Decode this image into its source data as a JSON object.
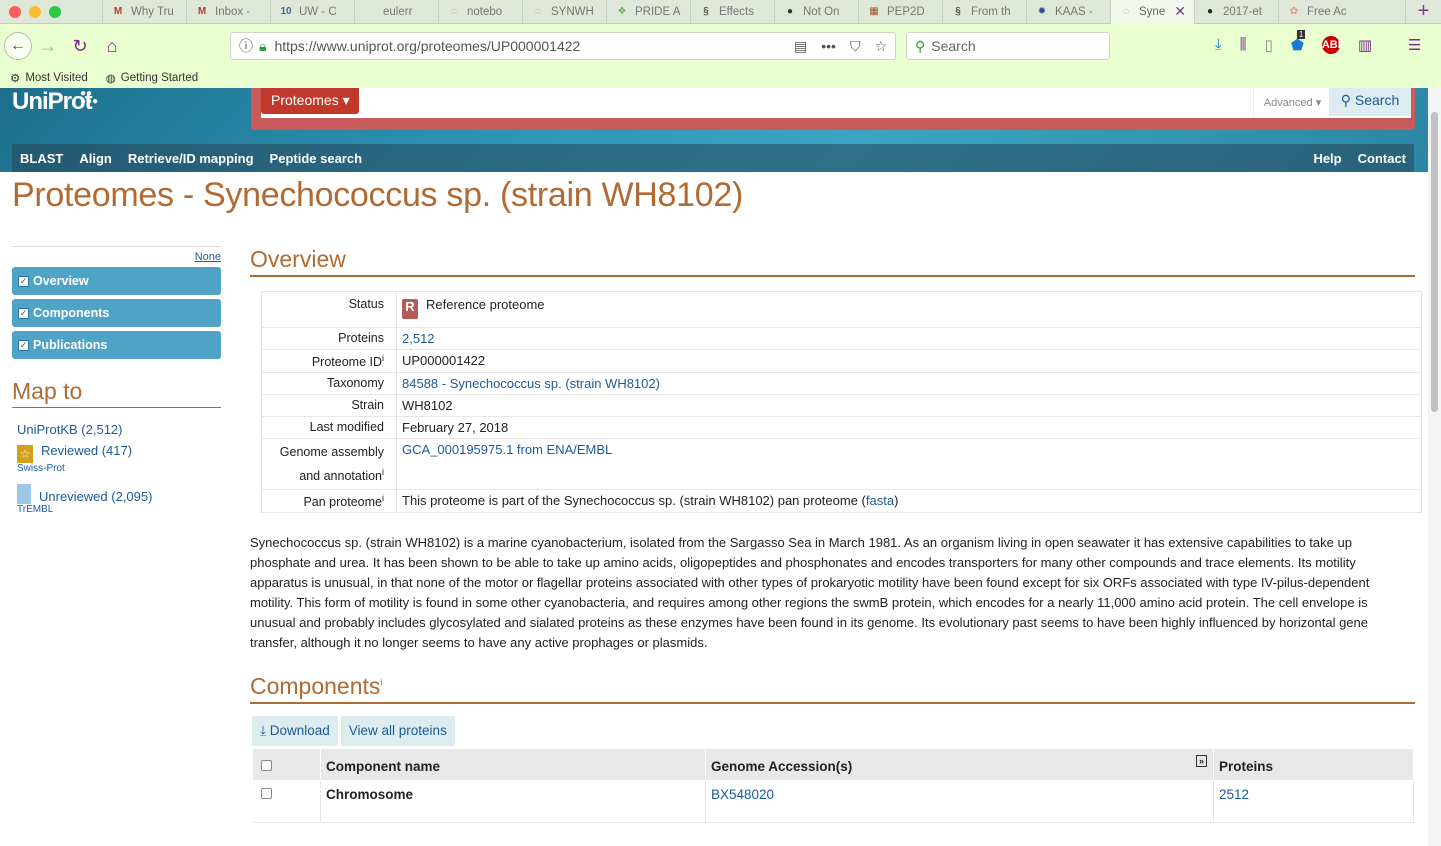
{
  "browser": {
    "tabs": [
      {
        "label": "Why Tru",
        "icon": "M",
        "color": "#c0392b"
      },
      {
        "label": "Inbox -",
        "icon": "M",
        "color": "#c0392b"
      },
      {
        "label": "UW - C",
        "icon": "10",
        "color": "#2a6fb0"
      },
      {
        "label": "eulerr",
        "icon": "",
        "color": "#888"
      },
      {
        "label": "notebo",
        "icon": "◌",
        "color": "#e67e22"
      },
      {
        "label": "SYNWH",
        "icon": "◌",
        "color": "#e67e22"
      },
      {
        "label": "PRIDE A",
        "icon": "❖",
        "color": "#6ab04c"
      },
      {
        "label": "Effects",
        "icon": "§",
        "color": "#555"
      },
      {
        "label": "Not On",
        "icon": "●",
        "color": "#333"
      },
      {
        "label": "PEP2D",
        "icon": "▦",
        "color": "#a0522d"
      },
      {
        "label": "From th",
        "icon": "§",
        "color": "#555"
      },
      {
        "label": "KAAS -",
        "icon": "✹",
        "color": "#2a4f8a"
      },
      {
        "label": "Syne",
        "icon": "◌",
        "color": "#4aa3d0",
        "active": true
      },
      {
        "label": "2017-et",
        "icon": "●",
        "color": "#222"
      },
      {
        "label": "Free Ac",
        "icon": "✿",
        "color": "#d98"
      }
    ],
    "url": "https://www.uniprot.org/proteomes/UP000001422",
    "search_placeholder": "Search",
    "notification_count": "1",
    "bookmarks": [
      "Most Visited",
      "Getting Started"
    ]
  },
  "site": {
    "logo": "UniProt",
    "dataset_button": "Proteomes ▾",
    "advanced": "Advanced ▾",
    "search_button": "Search",
    "menu_left": [
      "BLAST",
      "Align",
      "Retrieve/ID mapping",
      "Peptide search"
    ],
    "menu_right": [
      "Help",
      "Contact"
    ]
  },
  "page_title": "Proteomes - Synechococcus sp. (strain WH8102)",
  "sidenav": {
    "none_label": "None",
    "items": [
      "Overview",
      "Components",
      "Publications"
    ]
  },
  "mapto": {
    "heading": "Map to",
    "uniprotkb": "UniProtKB (2,512)",
    "reviewed": "Reviewed (417)",
    "reviewed_sub": "Swiss-Prot",
    "unreviewed": "Unreviewed (2,095)",
    "unreviewed_sub": "TrEMBL"
  },
  "overview": {
    "heading": "Overview",
    "rows": {
      "status_k": "Status",
      "status_v": "Reference proteome",
      "proteins_k": "Proteins",
      "proteins_v": "2,512",
      "pid_k": "Proteome ID",
      "pid_v": "UP000001422",
      "tax_k": "Taxonomy",
      "tax_v": "84588 - Synechococcus sp. (strain WH8102)",
      "strain_k": "Strain",
      "strain_v": "WH8102",
      "mod_k": "Last modified",
      "mod_v": "February 27, 2018",
      "ga_k1": "Genome assembly",
      "ga_k2": "and annotation",
      "ga_v": "GCA_000195975.1 from ENA/EMBL",
      "pan_k": "Pan proteome",
      "pan_v_pre": "This proteome is part of the Synechococcus sp. (strain WH8102) pan proteome (",
      "pan_link": "fasta",
      "pan_v_post": ")"
    },
    "description": "Synechococcus sp. (strain WH8102) is a marine cyanobacterium, isolated from the Sargasso Sea in March 1981. As an organism living in open seawater it has extensive capabilities to take up phosphate and urea. It has been shown to be able to take up amino acids, oligopeptides and phosphonates and encodes transporters for many other compounds and trace elements. Its motility apparatus is unusual, in that none of the motor or flagellar proteins associated with other types of prokaryotic motility have been found except for six ORFs associated with type IV-pilus-dependent motility. This form of motility is found in some other cyanobacteria, and requires among other regions the swmB protein, which encodes for a nearly 11,000 amino acid protein. The cell envelope is unusual and probably includes glycosylated and sialated proteins as these enzymes have been found in its genome. Its evolutionary past seems to have been highly influenced by horizontal gene transfer, although it no longer seems to have any active prophages or plasmids."
  },
  "components": {
    "heading": "Components",
    "download": "Download",
    "view_all": "View all proteins",
    "columns": [
      "Component name",
      "Genome Accession(s)",
      "Proteins"
    ],
    "rows": [
      {
        "name": "Chromosome",
        "accession": "BX548020",
        "proteins": "2512"
      }
    ]
  }
}
